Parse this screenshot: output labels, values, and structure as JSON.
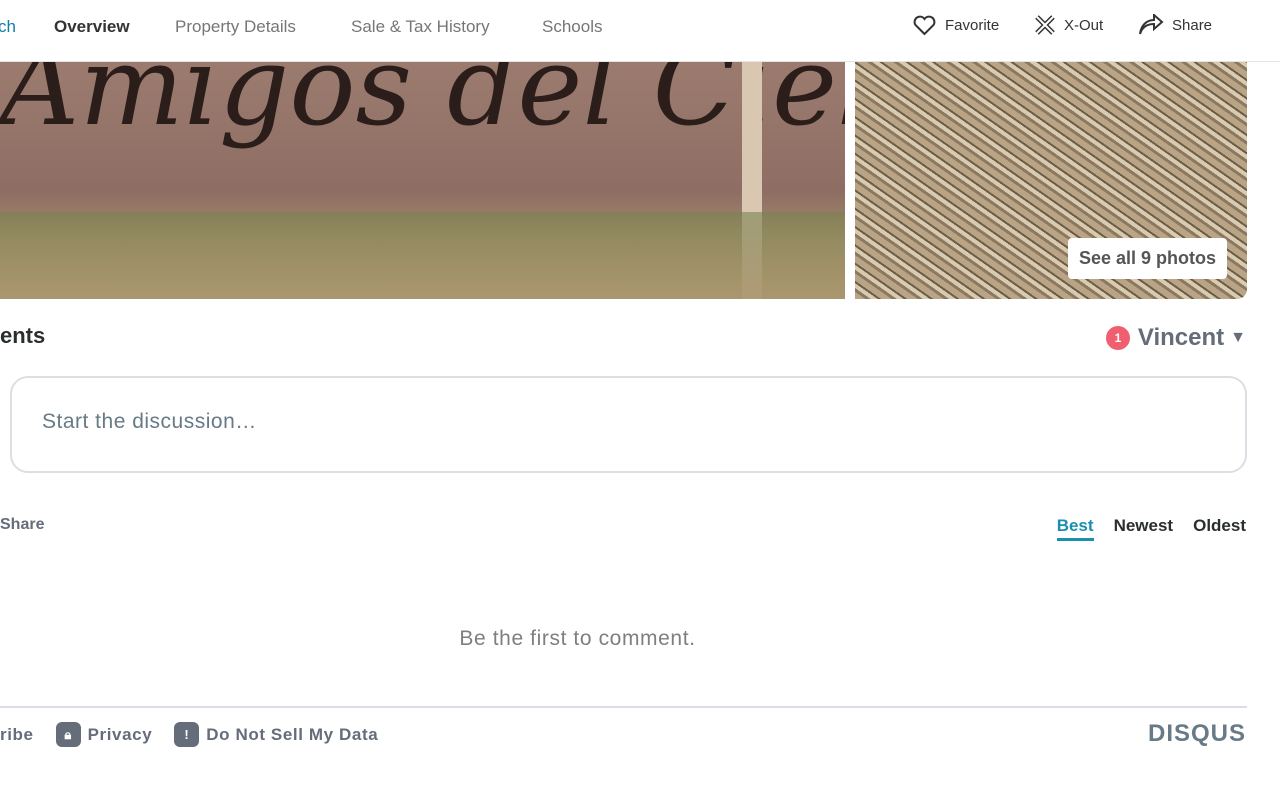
{
  "nav": {
    "items": [
      "ch",
      "Overview",
      "Property Details",
      "Sale & Tax History",
      "Schools"
    ],
    "actions": {
      "favorite": "Favorite",
      "xout": "X-Out",
      "share": "Share"
    }
  },
  "photos": {
    "sign_text": "Amigos del Cielo",
    "see_all": "See all 9 photos"
  },
  "comments": {
    "title": "ents",
    "user": "Vincent",
    "notification_count": "1",
    "placeholder": "Start the discussion…",
    "share": "Share",
    "sort": [
      "Best",
      "Newest",
      "Oldest"
    ],
    "empty": "Be the first to comment."
  },
  "footer": {
    "subscribe": "ribe",
    "privacy": "Privacy",
    "dnsmd": "Do Not Sell My Data",
    "brand": "DISQUS"
  }
}
